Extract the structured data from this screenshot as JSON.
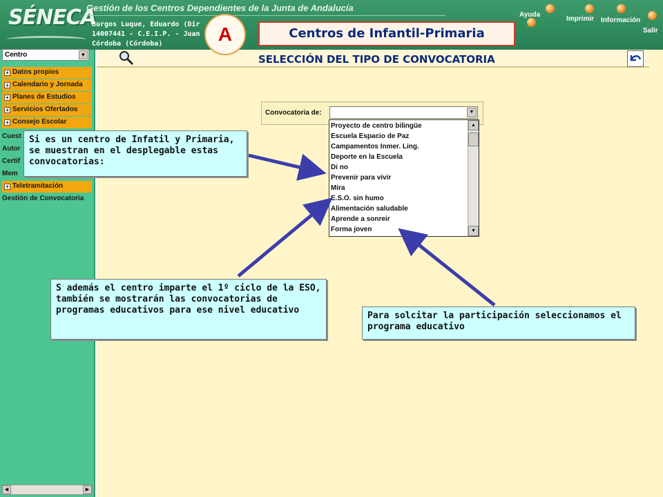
{
  "header": {
    "logo_text": "SÉNECA",
    "title": "Gestión de los Centros Dependientes de la Junta de Andalucía",
    "user_name": "Burgos Luque, Eduardo (Dir",
    "user_center": "14007441 - C.E.I.P. - Juan P",
    "user_city": "Córdoba (Córdoba)",
    "nav": {
      "help": "Ayuda",
      "print": "Imprimir",
      "info": "Información",
      "exit": "Salir"
    }
  },
  "overlay": {
    "badge": "A",
    "banner": "Centros de Infantil-Primaria"
  },
  "sidebar": {
    "select_value": "Centro",
    "menu": [
      {
        "label": "Datos propios"
      },
      {
        "label": "Calendario y Jornada"
      },
      {
        "label": "Planes de Estudios"
      },
      {
        "label": "Servicios Ofertados"
      },
      {
        "label": "Consejo Escolar"
      }
    ],
    "partial": [
      "Cuest",
      "Autor",
      "Certif",
      "Mem"
    ],
    "teletramitacion": "Teletramitación",
    "gestion": "Gestión de Convocatoria"
  },
  "main": {
    "title": "SELECCIÓN DEL TIPO DE CONVOCATORIA",
    "field_label": "Convocatoria de:",
    "options": [
      "Proyecto de centro bilingüe",
      "Escuela Espacio de Paz",
      "Campamentos Inmer. Ling.",
      "Deporte en la Escuela",
      "Di no",
      "Prevenir para vivir",
      "Mira",
      "E.S.O. sin humo",
      "Alimentación saludable",
      "Aprende a sonreir",
      "Forma joven"
    ]
  },
  "callouts": {
    "c1": "Si es un centro de Infatil y Primaria, se muestran en el desplegable estas convocatorias:",
    "c2": "S además el centro imparte el 1º ciclo de la ESO, también se mostrarán las convocatorias de programas educativos para ese nivel educativo",
    "c3": "Para solcitar la participación seleccionamos el programa educativo"
  },
  "colors": {
    "accent_green": "#4dc592",
    "menu_orange": "#f2a60f",
    "main_bg": "#fff5c8",
    "callout_bg": "#ccffff",
    "arrow": "#3b3dab"
  }
}
